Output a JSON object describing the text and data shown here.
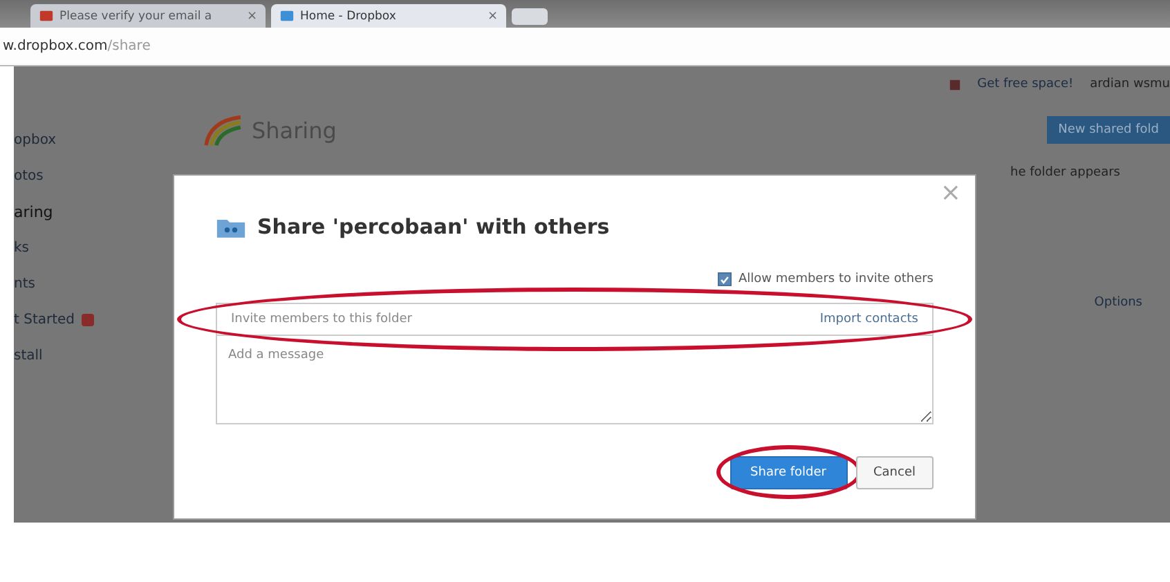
{
  "browser": {
    "tabs": [
      {
        "title": "Please verify your email a",
        "close": "×",
        "selected": false
      },
      {
        "title": "Home - Dropbox",
        "close": "×",
        "selected": true
      }
    ],
    "address": {
      "host": "w.dropbox.com",
      "path": "/share"
    }
  },
  "header": {
    "space_link": "Get free space!",
    "user": "ardian wsmu"
  },
  "sidebar": [
    {
      "label": "opbox",
      "selected": false,
      "badge": false
    },
    {
      "label": "otos",
      "selected": false,
      "badge": false
    },
    {
      "label": "aring",
      "selected": true,
      "badge": false
    },
    {
      "label": "ks",
      "selected": false,
      "badge": false
    },
    {
      "label": "nts",
      "selected": false,
      "badge": false
    },
    {
      "label": "t Started",
      "selected": false,
      "badge": true
    },
    {
      "label": "stall",
      "selected": false,
      "badge": false
    }
  ],
  "main": {
    "title": "Sharing",
    "new_button": "New shared fold",
    "hint": "he folder appears",
    "options": "Options"
  },
  "dialog": {
    "title": "Share 'percobaan' with others",
    "close": "×",
    "allow_invite": {
      "label": "Allow members to invite others",
      "checked": true
    },
    "invite": {
      "placeholder": "Invite members to this folder",
      "link": "Import contacts"
    },
    "message": {
      "placeholder": "Add a message"
    },
    "buttons": [
      {
        "label": "Share folder",
        "kind": "primary"
      },
      {
        "label": "Cancel",
        "kind": "secondary"
      }
    ]
  }
}
